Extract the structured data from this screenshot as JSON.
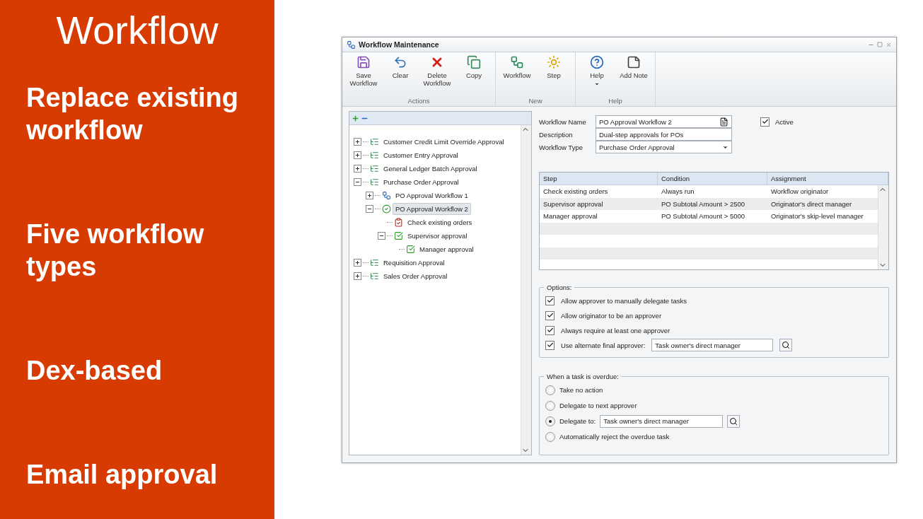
{
  "slide": {
    "title": "Workflow",
    "bullets": [
      "Replace existing workflow",
      "Five workflow types",
      "Dex-based",
      "Email approval"
    ]
  },
  "window": {
    "title": "Workflow Maintenance"
  },
  "ribbon": {
    "groups": [
      {
        "label": "Actions",
        "buttons": [
          {
            "label": "Save Workflow"
          },
          {
            "label": "Clear"
          },
          {
            "label": "Delete Workflow"
          },
          {
            "label": "Copy"
          }
        ]
      },
      {
        "label": "New",
        "buttons": [
          {
            "label": "Workflow"
          },
          {
            "label": "Step"
          }
        ]
      },
      {
        "label": "Help",
        "buttons": [
          {
            "label": "Help",
            "dropdown": true
          },
          {
            "label": "Add Note",
            "dropdown": false
          }
        ]
      }
    ]
  },
  "tree": [
    {
      "label": "Customer Credit Limit Override Approval",
      "kind": "type",
      "expanded": false,
      "selected": false
    },
    {
      "label": "Customer Entry Approval",
      "kind": "type",
      "expanded": false,
      "selected": false
    },
    {
      "label": "General Ledger Batch Approval",
      "kind": "type",
      "expanded": false,
      "selected": false
    },
    {
      "label": "Purchase Order Approval",
      "kind": "type",
      "expanded": true,
      "selected": false,
      "children": [
        {
          "label": "PO Approval Workflow 1",
          "kind": "workflow",
          "expanded": false,
          "selected": false
        },
        {
          "label": "PO Approval Workflow 2",
          "kind": "active",
          "expanded": true,
          "selected": true,
          "children": [
            {
              "label": "Check existing orders",
              "kind": "task",
              "selected": false
            },
            {
              "label": "Supervisor approval",
              "kind": "approval",
              "expanded": true,
              "selected": false,
              "children": [
                {
                  "label": "Manager approval",
                  "kind": "approval",
                  "selected": false
                }
              ]
            }
          ]
        }
      ]
    },
    {
      "label": "Requisition Approval",
      "kind": "type",
      "expanded": false,
      "selected": false
    },
    {
      "label": "Sales Order Approval",
      "kind": "type",
      "expanded": false,
      "selected": false
    }
  ],
  "form": {
    "name_label": "Workflow Name",
    "name_value": "PO Approval Workflow 2",
    "description_label": "Description",
    "description_value": "Dual-step approvals for POs",
    "type_label": "Workflow Type",
    "type_value": "Purchase Order Approval",
    "active": {
      "label": "Active",
      "checked": true
    }
  },
  "steps_table": {
    "columns": [
      "Step",
      "Condition",
      "Assignment"
    ],
    "rows": [
      [
        "Check existing orders",
        "Always run",
        "Workflow originator"
      ],
      [
        "Supervisor approval",
        "PO Subtotal Amount > 2500",
        "Originator's direct manager"
      ],
      [
        "Manager approval",
        "PO Subtotal Amount > 5000",
        "Originator's skip-level manager"
      ]
    ]
  },
  "options": {
    "title": "Options:",
    "items": [
      {
        "kind": "checkbox",
        "label": "Allow approver to manually delegate tasks",
        "checked": true
      },
      {
        "kind": "checkbox",
        "label": "Allow originator to be an approver",
        "checked": true
      },
      {
        "kind": "checkbox",
        "label": "Always require at least one approver",
        "checked": true
      },
      {
        "kind": "lookup",
        "label": "Use alternate final approver:",
        "checked": true,
        "value": "Task owner's direct manager"
      }
    ]
  },
  "overdue": {
    "title": "When a task is overdue:",
    "items": [
      {
        "kind": "radio",
        "label": "Take no action",
        "selected": false
      },
      {
        "kind": "radio",
        "label": "Delegate to next approver",
        "selected": false
      },
      {
        "kind": "lookup",
        "label": "Delegate to:",
        "selected": true,
        "value": "Task owner's direct manager"
      },
      {
        "kind": "radio",
        "label": "Automatically reject the overdue task",
        "selected": false
      }
    ]
  }
}
